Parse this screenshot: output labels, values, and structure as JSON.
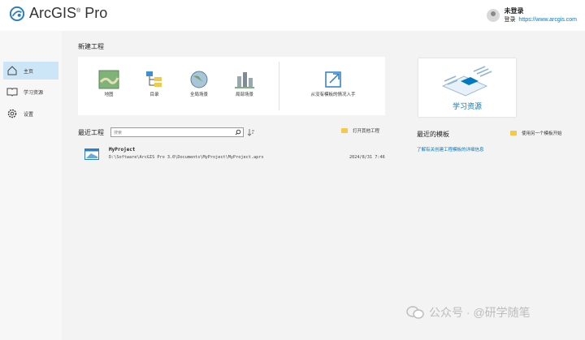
{
  "app": {
    "title": "ArcGIS",
    "title_suffix": "Pro",
    "reg_mark": "®"
  },
  "user": {
    "name": "未登录",
    "sign_in": "登录",
    "portal_url": "https://www.arcgis.com"
  },
  "sidebar": {
    "items": [
      {
        "label": "主页",
        "icon": "home-icon"
      },
      {
        "label": "学习资源",
        "icon": "book-icon"
      },
      {
        "label": "设置",
        "icon": "gear-icon"
      }
    ]
  },
  "new_project": {
    "title": "新建工程",
    "tiles": [
      {
        "label": "地图",
        "icon": "map-icon"
      },
      {
        "label": "目录",
        "icon": "catalog-icon"
      },
      {
        "label": "全局场景",
        "icon": "globe-icon"
      },
      {
        "label": "局部场景",
        "icon": "local-scene-icon"
      }
    ],
    "no_template_label": "从没有模板的情况入手"
  },
  "learning": {
    "label": "学习资源"
  },
  "recent_projects": {
    "title": "最近工程",
    "search_placeholder": "搜索",
    "open_other_label": "打开其他工程",
    "items": [
      {
        "name": "MyProject",
        "path": "D:\\Software\\ArcGIS Pro 3.0\\Documents\\MyProject\\MyProject.aprx",
        "date": "2024/8/31 7:46"
      }
    ]
  },
  "recent_templates": {
    "title": "最近的模板",
    "other_template_label": "使用另一个模板开始",
    "info_link": "了解有关创建工程模板的详细信息"
  },
  "watermark": {
    "text": "公众号 · @研学随笔"
  },
  "colors": {
    "accent": "#0079c1",
    "active_nav": "#cde6f7",
    "content_bg": "#f3f3f3"
  }
}
